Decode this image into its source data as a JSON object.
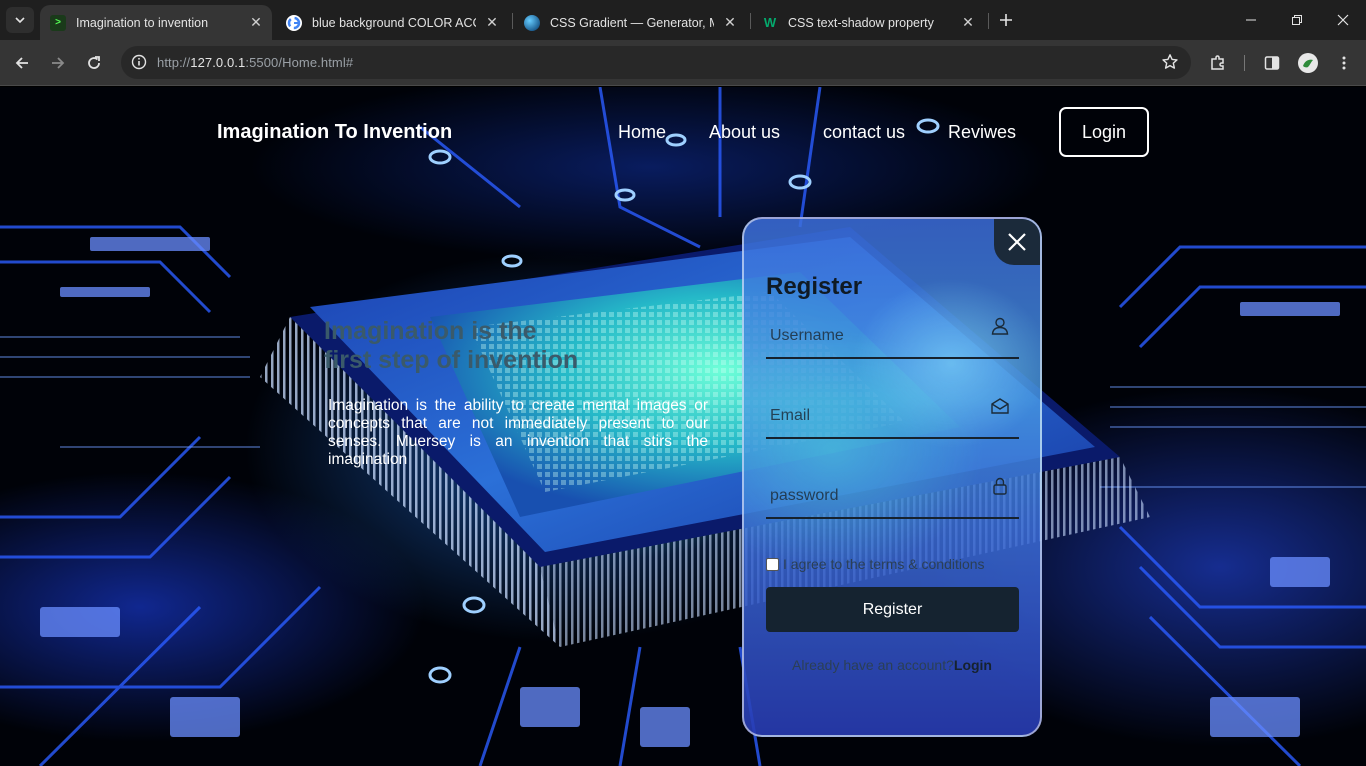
{
  "browser": {
    "tabs": [
      {
        "title": "Imagination to invention",
        "icon": "terminal-favicon",
        "active": true
      },
      {
        "title": "blue background COLOR ACCPET",
        "icon": "google-favicon",
        "active": false
      },
      {
        "title": "CSS Gradient — Generator, Maker",
        "icon": "cssgradient-favicon",
        "active": false
      },
      {
        "title": "CSS text-shadow property",
        "icon": "w3schools-favicon",
        "active": false
      }
    ],
    "url_prefix": "http://",
    "url_host": "127.0.0.1",
    "url_rest": ":5500/Home.html#"
  },
  "nav": {
    "brand": "Imagination To Invention",
    "links": [
      "Home",
      "About us",
      "contact us",
      "Reviwes"
    ],
    "login": "Login"
  },
  "hero": {
    "title_line1": "Imagination is the",
    "title_line2": "first step of invention",
    "text": "Imagination is the ability to create mental images or concepts that are not immediately present to our senses. Muersey is an invention that stirs the imagination"
  },
  "form": {
    "title": "Register",
    "username_placeholder": "Username",
    "email_placeholder": "Email",
    "password_placeholder": "password",
    "agree_label": "I agree to the terms & conditions",
    "submit": "Register",
    "have_account": "Already have an account?",
    "login_link": "Login"
  },
  "colors": {
    "accent_dark": "#152330",
    "nav_text": "#ffffff",
    "hero_title": "#3a5a6a"
  }
}
